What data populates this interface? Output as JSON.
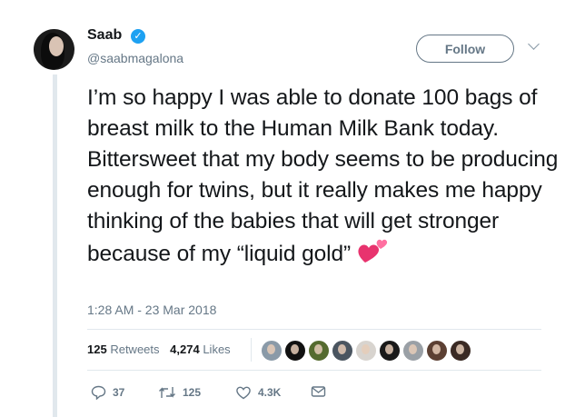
{
  "author": {
    "name": "Saab",
    "handle": "@saabmagalona",
    "verified_icon": "verified-check-icon"
  },
  "header": {
    "follow_label": "Follow",
    "menu_icon": "chevron-down-icon"
  },
  "tweet": {
    "text": "I’m so happy I was able to donate 100 bags of breast milk to the Human Milk Bank today. Bittersweet that my body seems to be producing enough for twins, but it really makes me happy thinking of the babies that will get stronger because of my “liquid gold”",
    "emoji_icon": "two-hearts-icon",
    "timestamp": "1:28 AM - 23 Mar 2018"
  },
  "stats": {
    "retweets_count": "125",
    "retweets_label": "Retweets",
    "likes_count": "4,274",
    "likes_label": "Likes",
    "liker_avatars": [
      {
        "color": "#8a9aa8"
      },
      {
        "color": "#111111"
      },
      {
        "color": "#556b2f"
      },
      {
        "color": "#4a5560"
      },
      {
        "color": "#d8d4cf"
      },
      {
        "color": "#1a1a1a"
      },
      {
        "color": "#9aa0a6"
      },
      {
        "color": "#5c4033"
      },
      {
        "color": "#3a2a24"
      }
    ]
  },
  "actions": {
    "reply_count": "37",
    "retweet_count": "125",
    "like_count": "4.3K"
  },
  "colors": {
    "text": "#14171a",
    "muted": "#657786",
    "verified_blue": "#1da1f2",
    "divider": "#e1e8ed",
    "heart_pink": "#e8336e"
  }
}
